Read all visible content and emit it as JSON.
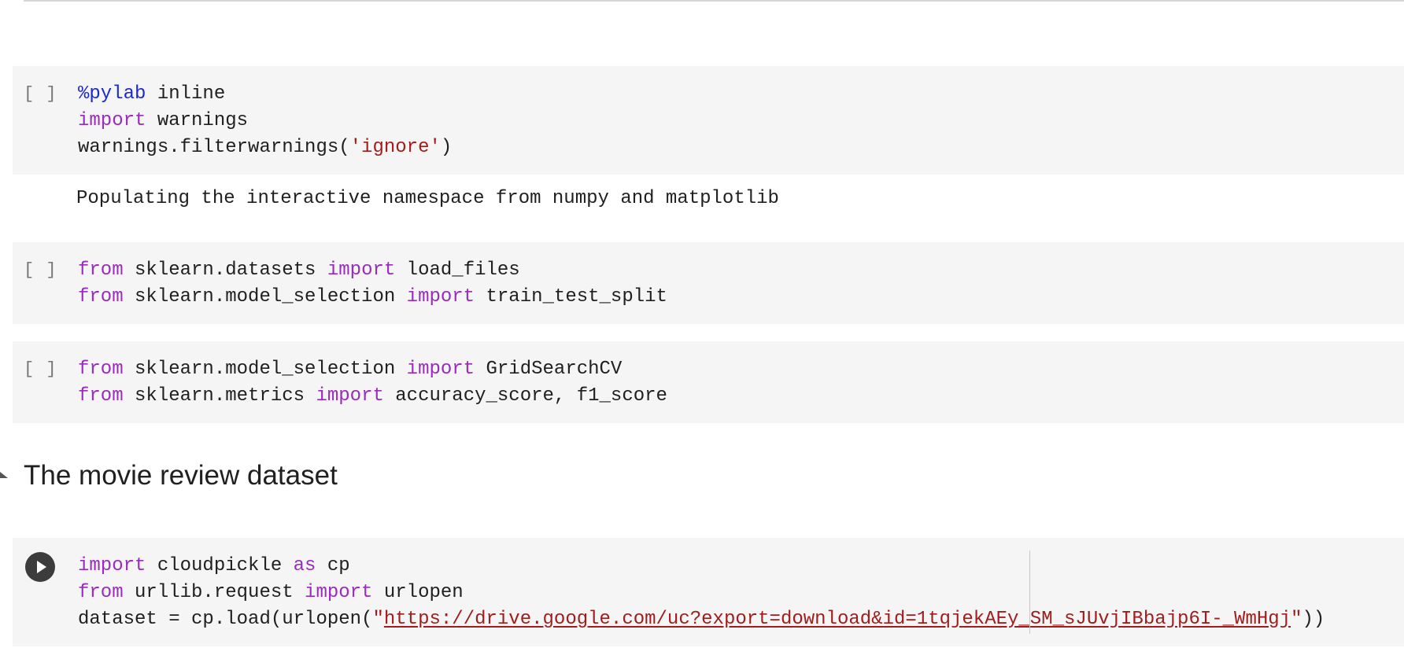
{
  "cells": [
    {
      "indicator": "[ ]",
      "lines": [
        [
          {
            "t": "%pylab",
            "c": "magic"
          },
          {
            "t": " inline",
            "c": ""
          }
        ],
        [
          {
            "t": "import",
            "c": "kw"
          },
          {
            "t": " warnings",
            "c": ""
          }
        ],
        [
          {
            "t": "warnings.filterwarnings(",
            "c": ""
          },
          {
            "t": "'ignore'",
            "c": "str"
          },
          {
            "t": ")",
            "c": ""
          }
        ]
      ],
      "output": "Populating the interactive namespace from numpy and matplotlib"
    },
    {
      "indicator": "[ ]",
      "lines": [
        [
          {
            "t": "from",
            "c": "kw"
          },
          {
            "t": " sklearn.datasets ",
            "c": ""
          },
          {
            "t": "import",
            "c": "kw"
          },
          {
            "t": " load_files",
            "c": ""
          }
        ],
        [
          {
            "t": "from",
            "c": "kw"
          },
          {
            "t": " sklearn.model_selection ",
            "c": ""
          },
          {
            "t": "import",
            "c": "kw"
          },
          {
            "t": " train_test_split",
            "c": ""
          }
        ]
      ]
    },
    {
      "indicator": "[ ]",
      "lines": [
        [
          {
            "t": "from",
            "c": "kw"
          },
          {
            "t": " sklearn.model_selection ",
            "c": ""
          },
          {
            "t": "import",
            "c": "kw"
          },
          {
            "t": " GridSearchCV",
            "c": ""
          }
        ],
        [
          {
            "t": "from",
            "c": "kw"
          },
          {
            "t": " sklearn.metrics ",
            "c": ""
          },
          {
            "t": "import",
            "c": "kw"
          },
          {
            "t": " accuracy_score, f1_score",
            "c": ""
          }
        ]
      ]
    }
  ],
  "section": {
    "title": "The movie review dataset"
  },
  "active_cell": {
    "lines": [
      [
        {
          "t": "import",
          "c": "kw"
        },
        {
          "t": " cloudpickle ",
          "c": ""
        },
        {
          "t": "as",
          "c": "kw"
        },
        {
          "t": " cp",
          "c": ""
        }
      ],
      [
        {
          "t": "from",
          "c": "kw"
        },
        {
          "t": " urllib.request ",
          "c": ""
        },
        {
          "t": "import",
          "c": "kw"
        },
        {
          "t": " urlopen",
          "c": ""
        }
      ],
      [
        {
          "t": "dataset = cp.load(urlopen(",
          "c": ""
        },
        {
          "t": "\"",
          "c": "str"
        },
        {
          "t": "https://drive.google.com/uc?export=download&id=1tqjekAEy_SM_sJUvjIBbajp6I-_WmHgj",
          "c": "url"
        },
        {
          "t": "\"",
          "c": "str"
        },
        {
          "t": "))",
          "c": ""
        }
      ]
    ]
  },
  "colors": {
    "keyword": "#9a2bbd",
    "magic": "#1a29d4",
    "string": "#a11d1d",
    "cell_bg": "#f5f5f5"
  },
  "icons": {
    "run": "play-circle-icon",
    "section_toggle": "collapse-triangle-icon"
  }
}
